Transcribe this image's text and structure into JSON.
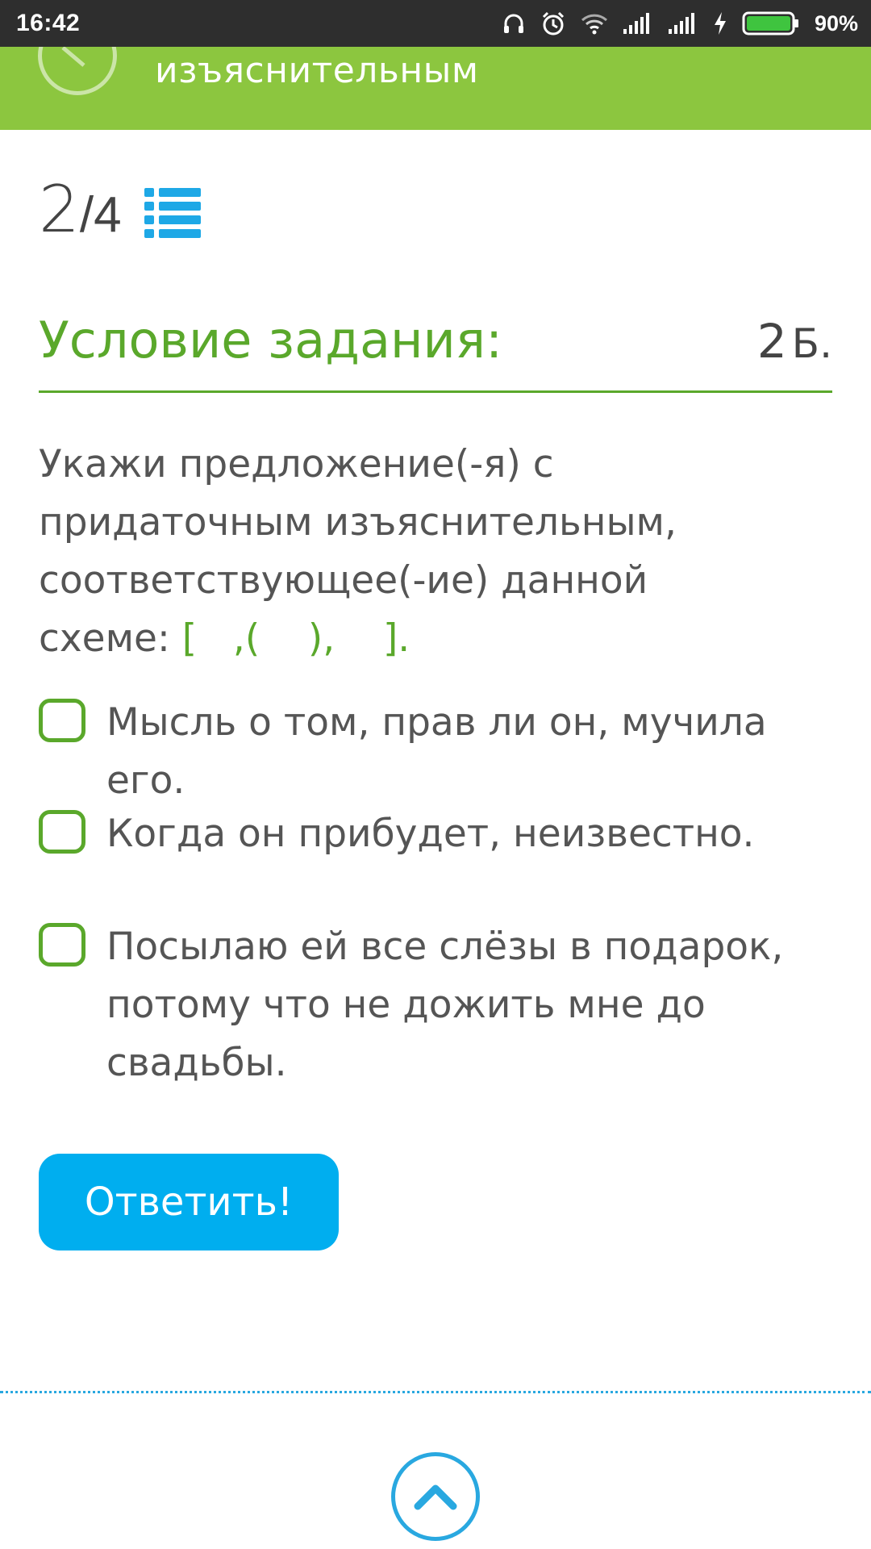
{
  "status_bar": {
    "time": "16:42",
    "battery_percent": "90%",
    "icons": [
      "headphones-icon",
      "alarm-icon",
      "wifi-icon",
      "signal-icon",
      "signal-icon",
      "charging-icon",
      "battery-icon"
    ]
  },
  "header": {
    "title": "изъяснительным",
    "background_color": "#8cc63f"
  },
  "progress": {
    "current": "2",
    "separator": "/",
    "total": "4"
  },
  "condition": {
    "title": "Условие задания:",
    "points_value": "2",
    "points_unit": "Б."
  },
  "question": {
    "text": "Укажи предложение(-я) с придаточным изъяснительным, соответствующее(-ие) данной схеме: ",
    "scheme": "[   ,(    ),    ]."
  },
  "options": [
    {
      "label": "Мысль о том, прав ли он, мучила его.",
      "checked": false
    },
    {
      "label": "Когда он прибудет, неизвестно.",
      "checked": false
    },
    {
      "label": "Посылаю ей все слёзы в подарок, потому что не дожить мне до свадьбы.",
      "checked": false
    }
  ],
  "answer_button": {
    "label": "Ответить!"
  },
  "colors": {
    "accent_green": "#5aa82b",
    "header_green": "#8cc63f",
    "button_blue": "#00aeef",
    "text_gray": "#555555"
  }
}
